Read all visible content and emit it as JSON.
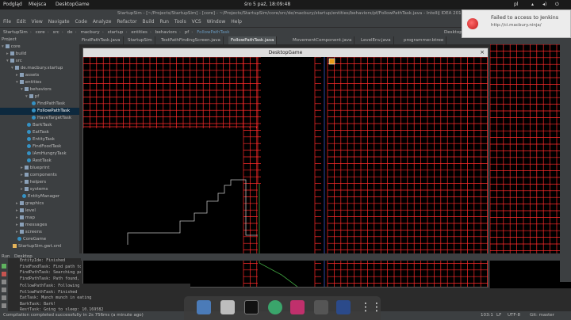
{
  "os_topbar": {
    "left_items": [
      "Podgląd",
      "Miejsca",
      "DesktopGame"
    ],
    "clock": "śro  5 paź, 18:09:48",
    "lang": "pl"
  },
  "ide": {
    "window_title": "StartupSim - [~/Projects/StartupSim] - [core] - ~/Projects/StartupSim/core/src/de/macbury/startup/entities/behaviors/pf/FollowPathTask.java - IntelliJ IDEA 2016.2.3",
    "menu": [
      "File",
      "Edit",
      "View",
      "Navigate",
      "Code",
      "Analyze",
      "Refactor",
      "Build",
      "Run",
      "Tools",
      "VCS",
      "Window",
      "Help"
    ],
    "breadcrumbs": [
      "StartupSim",
      "core",
      "src",
      "de",
      "macbury",
      "startup",
      "entities",
      "behaviors",
      "pf",
      "FollowPathTask"
    ],
    "project_label": "Project",
    "tabs": [
      "FindPathTask.java",
      "StartupSim",
      "TestPathFindingScreen.java",
      "FollowPathTask.java",
      "MovementComponent.java",
      "LevelEnv.java",
      "programmer.btree"
    ],
    "run_config": "Desktop"
  },
  "tree": [
    {
      "label": "core",
      "indent": 0,
      "icon": "folder",
      "fold": "▾"
    },
    {
      "label": "build",
      "indent": 1,
      "icon": "folder",
      "fold": "▸"
    },
    {
      "label": "src",
      "indent": 1,
      "icon": "folder",
      "fold": "▾"
    },
    {
      "label": "de.macbury.startup",
      "indent": 2,
      "icon": "folder",
      "fold": "▾"
    },
    {
      "label": "assets",
      "indent": 3,
      "icon": "folder",
      "fold": "▸"
    },
    {
      "label": "entities",
      "indent": 3,
      "icon": "folder",
      "fold": "▾"
    },
    {
      "label": "behaviors",
      "indent": 4,
      "icon": "folder",
      "fold": "▾"
    },
    {
      "label": "pf",
      "indent": 5,
      "icon": "folder",
      "fold": "▾"
    },
    {
      "label": "FindPathTask",
      "indent": 6,
      "icon": "class",
      "fold": ""
    },
    {
      "label": "FollowPathTask",
      "indent": 6,
      "icon": "class",
      "fold": "",
      "selected": true
    },
    {
      "label": "HaveTargetTask",
      "indent": 6,
      "icon": "class",
      "fold": ""
    },
    {
      "label": "BarkTask",
      "indent": 5,
      "icon": "class",
      "fold": ""
    },
    {
      "label": "EatTask",
      "indent": 5,
      "icon": "class",
      "fold": ""
    },
    {
      "label": "EntityTask",
      "indent": 5,
      "icon": "class",
      "fold": ""
    },
    {
      "label": "FindFoodTask",
      "indent": 5,
      "icon": "class",
      "fold": ""
    },
    {
      "label": "IAmHungryTask",
      "indent": 5,
      "icon": "class",
      "fold": ""
    },
    {
      "label": "RestTask",
      "indent": 5,
      "icon": "class",
      "fold": ""
    },
    {
      "label": "blueprint",
      "indent": 4,
      "icon": "folder",
      "fold": "▸"
    },
    {
      "label": "components",
      "indent": 4,
      "icon": "folder",
      "fold": "▸"
    },
    {
      "label": "helpers",
      "indent": 4,
      "icon": "folder",
      "fold": "▸"
    },
    {
      "label": "systems",
      "indent": 4,
      "icon": "folder",
      "fold": "▸"
    },
    {
      "label": "EntityManager",
      "indent": 4,
      "icon": "class",
      "fold": ""
    },
    {
      "label": "graphics",
      "indent": 3,
      "icon": "folder",
      "fold": "▸"
    },
    {
      "label": "level",
      "indent": 3,
      "icon": "folder",
      "fold": "▸"
    },
    {
      "label": "map",
      "indent": 3,
      "icon": "folder",
      "fold": "▸"
    },
    {
      "label": "messages",
      "indent": 3,
      "icon": "folder",
      "fold": "▸"
    },
    {
      "label": "screens",
      "indent": 3,
      "icon": "folder",
      "fold": "▸"
    },
    {
      "label": "CoreGame",
      "indent": 3,
      "icon": "class",
      "fold": ""
    },
    {
      "label": "StartupSim.gwt.xml",
      "indent": 2,
      "icon": "xml",
      "fold": ""
    }
  ],
  "game_window": {
    "title": "DesktopGame",
    "close": "×"
  },
  "run_panel": {
    "label": "Run",
    "config": "Desktop"
  },
  "console_lines": [
    "EntityIde: Finished",
    "FindFoodTask: Find path to",
    "FindPathTask: Searching pa",
    "FindPathTask: Path found,",
    "FollowPathTask: Following",
    "FollowPathTask: Finished",
    "EatTask: Munch munch in eating",
    "BarkTask: Bark!",
    "RestTask: Going to sleep: 10.169582"
  ],
  "status": {
    "message": "Compilation completed successfully in 2s 756ms (a minute ago)",
    "position": "103:1",
    "line_sep": "LF",
    "encoding": "UTF-8",
    "vcs": "Git: master"
  },
  "notification": {
    "title": "Failed to access to Jenkins",
    "url": "http://ci.macbury.ninja/"
  },
  "colors": {
    "grid": "#ff2a2a",
    "path": "#bfbfbf",
    "green_path": "#3fa03f",
    "blue_path": "#3a5bd0",
    "accent": "#0d293e"
  }
}
